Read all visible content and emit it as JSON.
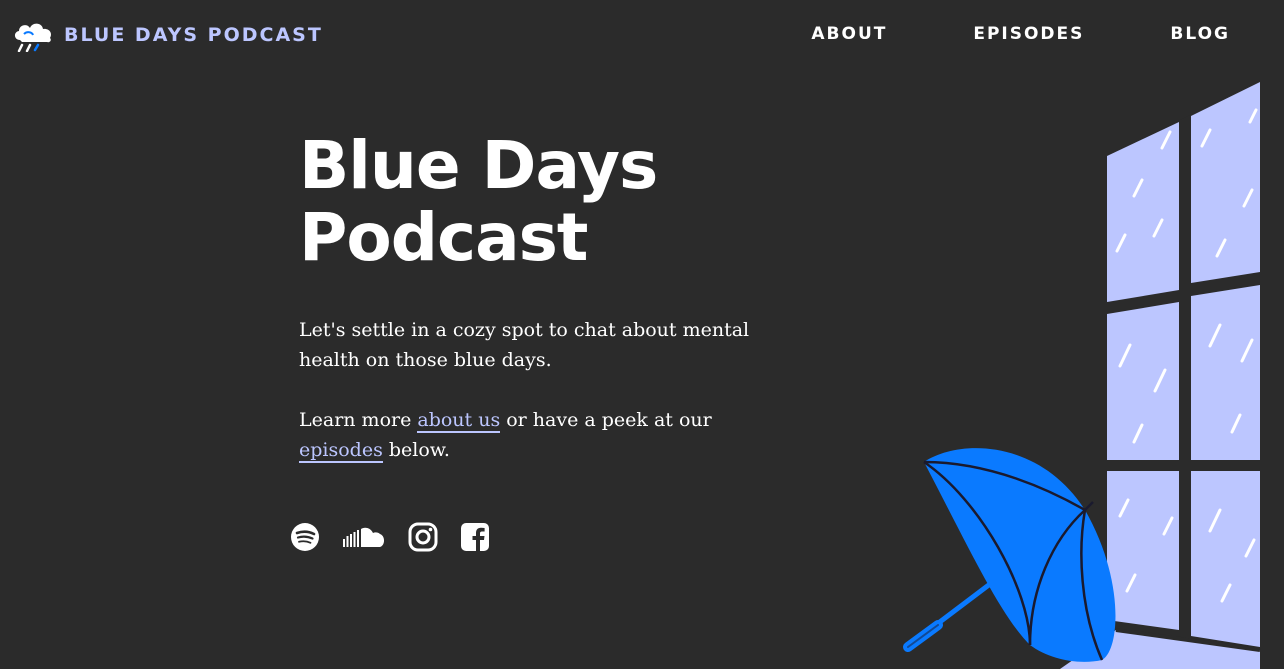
{
  "header": {
    "brand_name": "BLUE DAYS PODCAST",
    "logo_icon": "cloud-rain-icon",
    "nav": [
      {
        "label": "ABOUT"
      },
      {
        "label": "EPISODES"
      },
      {
        "label": "BLOG"
      }
    ]
  },
  "hero": {
    "title_line1": "Blue Days",
    "title_line2": "Podcast",
    "intro": "Let's settle in a cozy spot to chat about mental health on those blue days.",
    "learn_prefix": "Learn more ",
    "learn_link_about": "about us",
    "learn_middle": " or have a peek at our ",
    "learn_link_episodes": "episodes",
    "learn_suffix": " below."
  },
  "socials": [
    {
      "icon": "spotify-icon"
    },
    {
      "icon": "soundcloud-icon"
    },
    {
      "icon": "instagram-icon"
    },
    {
      "icon": "facebook-icon"
    }
  ],
  "illustration": {
    "description_icons": [
      "window-icon",
      "umbrella-icon",
      "rain-icon"
    ]
  },
  "colors": {
    "background": "#2b2b2b",
    "accent": "#bcc6ff",
    "umbrella": "#0a7aff",
    "window_pane": "#bcc6ff",
    "text": "#ffffff"
  }
}
